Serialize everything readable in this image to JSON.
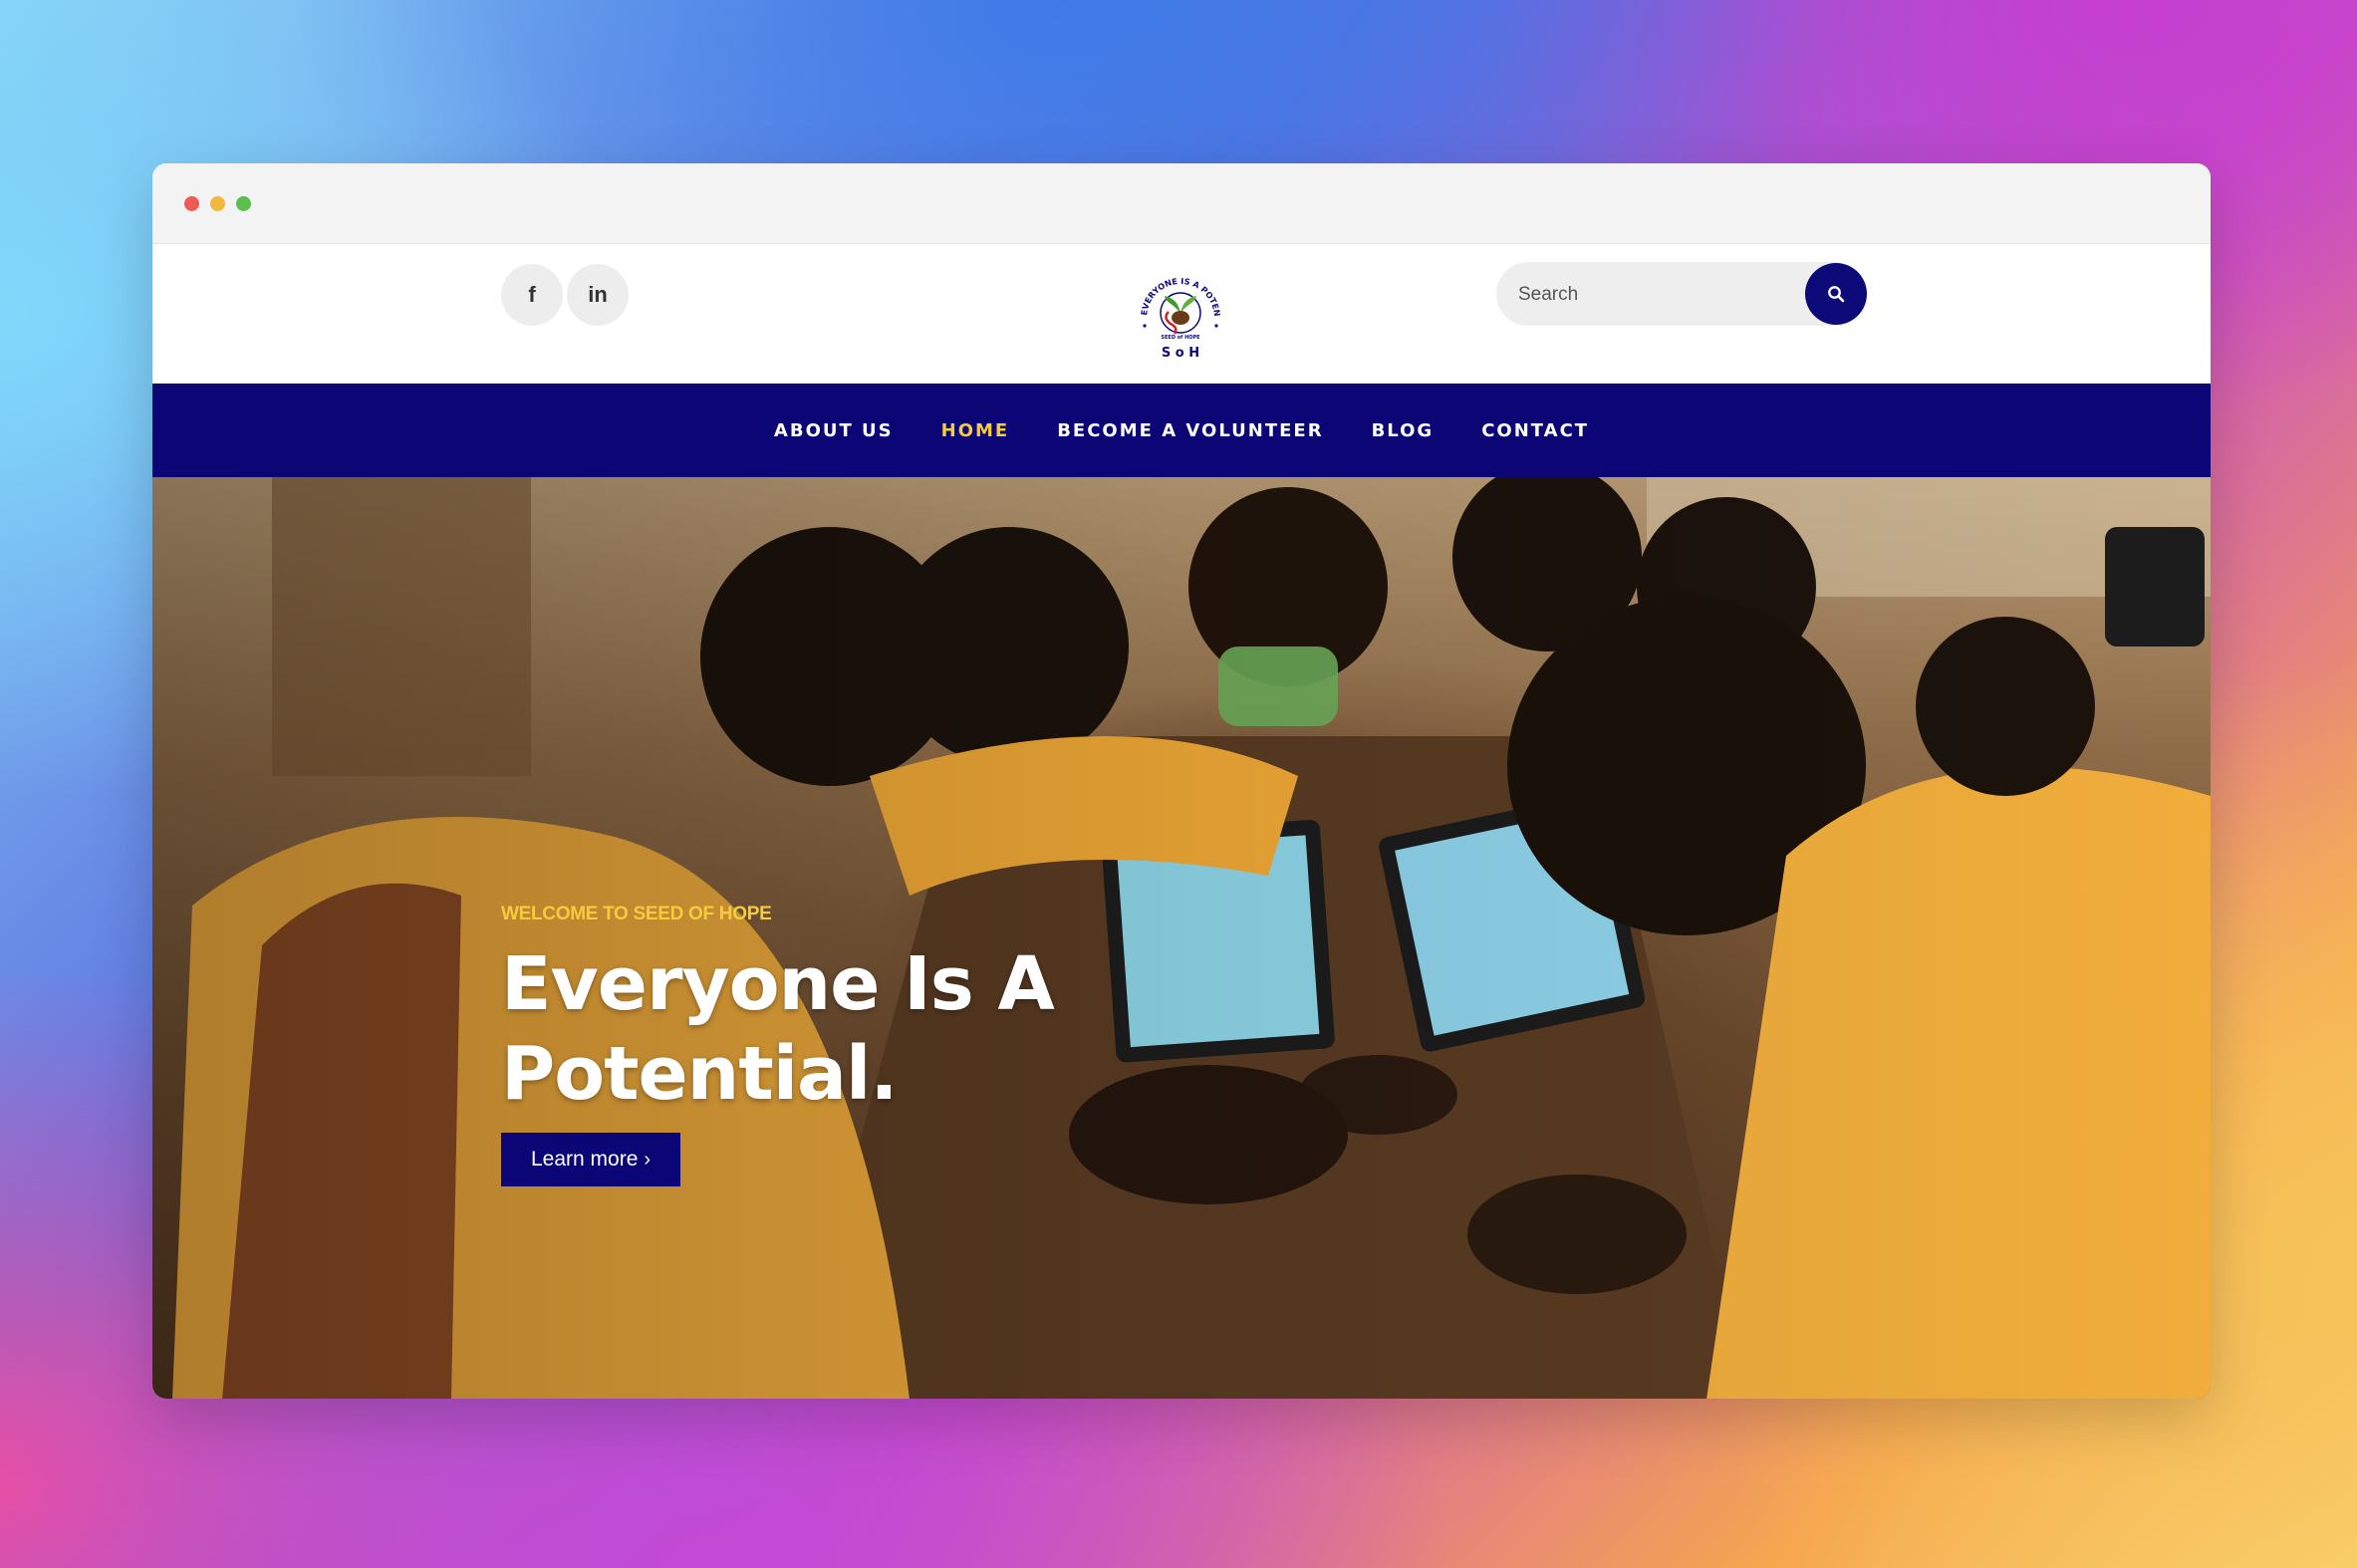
{
  "header": {
    "social": [
      {
        "icon": "facebook-icon",
        "glyph": "f"
      },
      {
        "icon": "linkedin-icon",
        "glyph": "in"
      }
    ],
    "logo": {
      "ring_text": "EVERYONE IS A POTENTIAL",
      "inner_text": "SEED of HOPE",
      "abbr": "S o H"
    },
    "search": {
      "placeholder": "Search",
      "icon": "search-icon"
    }
  },
  "nav": {
    "items": [
      {
        "label": "ABOUT US",
        "active": false
      },
      {
        "label": "HOME",
        "active": true
      },
      {
        "label": "BECOME A VOLUNTEER",
        "active": false
      },
      {
        "label": "BLOG",
        "active": false
      },
      {
        "label": "CONTACT",
        "active": false
      }
    ]
  },
  "hero": {
    "kicker": "WELCOME TO SEED OF HOPE",
    "headline_line1": "Everyone Is A",
    "headline_line2": "Potential.",
    "cta_label": "Learn more",
    "cta_icon": "chevron-right-icon"
  },
  "colors": {
    "brand_navy": "#0c0575",
    "accent_yellow": "#f4cc3e"
  }
}
